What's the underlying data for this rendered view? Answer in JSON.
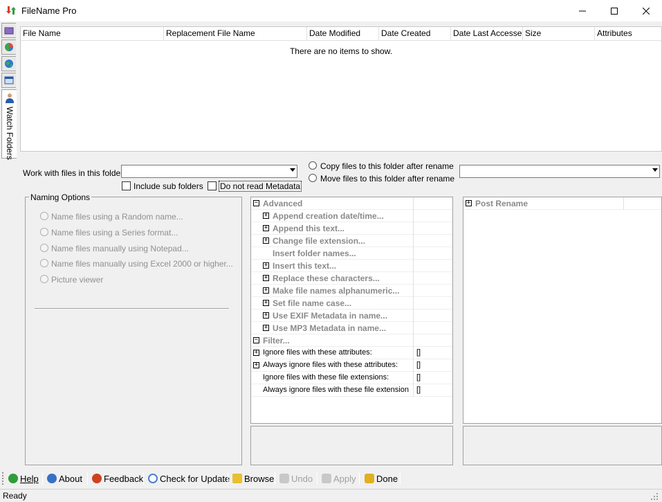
{
  "window": {
    "title": "FileName Pro",
    "min_glyph": "—",
    "max_glyph": "☐",
    "close_glyph": "✕"
  },
  "side_tabs": {
    "icons": [
      "folder-icon",
      "pie-chart-icon",
      "globe-icon",
      "window-icon",
      "user-icon"
    ],
    "watch_label": "Watch Folders"
  },
  "file_list": {
    "columns": [
      "File Name",
      "Replacement File Name",
      "Date Modified",
      "Date Created",
      "Date Last Accessed",
      "Size",
      "Attributes"
    ],
    "empty_message": "There are no items to show."
  },
  "work": {
    "label": "Work with files in this folder:",
    "folder_value": "",
    "include_sub_label": "Include sub folders",
    "include_sub_checked": false,
    "no_metadata_label": "Do not read Metadata",
    "no_metadata_checked": false,
    "copy_label": "Copy files to this folder after rename",
    "move_label": "Move files to this folder after rename",
    "dest_value": ""
  },
  "naming": {
    "title": "Naming Options",
    "options": [
      "Name files using a Random name...",
      "Name files using a Series format...",
      "Name files manually using Notepad...",
      "Name files manually using Excel 2000 or higher...",
      "Picture viewer"
    ]
  },
  "advanced": {
    "rows": [
      {
        "expander": "minus",
        "label": "Advanced",
        "style": "grey-bold",
        "indent": 0,
        "value": ""
      },
      {
        "expander": "plus",
        "label": "Append creation date/time...",
        "style": "grey-bold",
        "indent": 1,
        "value": ""
      },
      {
        "expander": "plus",
        "label": "Append this text...",
        "style": "grey-bold",
        "indent": 1,
        "value": ""
      },
      {
        "expander": "plus",
        "label": "Change file extension...",
        "style": "grey-bold",
        "indent": 1,
        "value": ""
      },
      {
        "expander": "none",
        "label": "Insert folder names...",
        "style": "grey-bold",
        "indent": 1,
        "value": ""
      },
      {
        "expander": "plus",
        "label": "Insert this text...",
        "style": "grey-bold",
        "indent": 1,
        "value": ""
      },
      {
        "expander": "plus",
        "label": "Replace these characters...",
        "style": "grey-bold",
        "indent": 1,
        "value": ""
      },
      {
        "expander": "plus",
        "label": "Make file names alphanumeric...",
        "style": "grey-bold",
        "indent": 1,
        "value": ""
      },
      {
        "expander": "plus",
        "label": "Set file name case...",
        "style": "grey-bold",
        "indent": 1,
        "value": ""
      },
      {
        "expander": "plus",
        "label": "Use EXIF Metadata in name...",
        "style": "grey-bold",
        "indent": 1,
        "value": ""
      },
      {
        "expander": "plus",
        "label": "Use MP3 Metadata in name...",
        "style": "grey-bold",
        "indent": 1,
        "value": ""
      },
      {
        "expander": "minus",
        "label": "Filter...",
        "style": "grey-bold",
        "indent": 0,
        "value": ""
      },
      {
        "expander": "plus",
        "label": "Ignore files with these attributes:",
        "style": "plain",
        "indent": 0,
        "value": "[]"
      },
      {
        "expander": "plus",
        "label": "Always ignore files with these attributes:",
        "style": "plain",
        "indent": 0,
        "value": "[]"
      },
      {
        "expander": "none",
        "label": "Ignore files with these file extensions:",
        "style": "plain",
        "indent": 0,
        "value": "[]"
      },
      {
        "expander": "none",
        "label": "Always ignore files with these file extension",
        "style": "plain",
        "indent": 0,
        "value": "[]"
      }
    ]
  },
  "post_rename": {
    "label": "Post Rename"
  },
  "toolbar": {
    "help": "Help",
    "about": "About",
    "feedback": "Feedback",
    "check_update": "Check for Update",
    "browse": "Browse",
    "undo": "Undo",
    "apply": "Apply",
    "done": "Done"
  },
  "status": {
    "text": "Ready"
  },
  "colors": {
    "help_icon": "#2e9e3a",
    "about_icon": "#3a6fc8",
    "feedback_icon": "#d04020",
    "update_icon": "#4a7fd0",
    "browse_icon": "#e8c030",
    "disabled_icon": "#b0b0b0",
    "done_icon": "#e0b020"
  }
}
